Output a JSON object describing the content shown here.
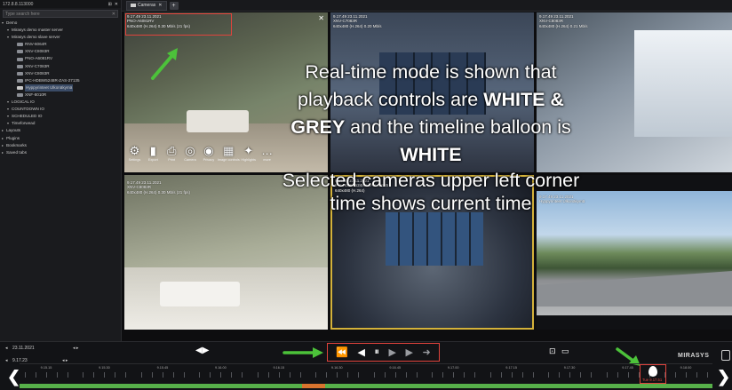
{
  "sidebar": {
    "header": "172.8.8.113000",
    "search_placeholder": "Type search here",
    "tree": [
      {
        "label": "Demo",
        "level": 0,
        "type": "folder"
      },
      {
        "label": "Mirasys demo master server",
        "level": 1,
        "type": "server"
      },
      {
        "label": "Mirasys demo slave server",
        "level": 1,
        "type": "server"
      },
      {
        "label": "RNV-6064R",
        "level": 2,
        "type": "camera"
      },
      {
        "label": "XNV-C8083R",
        "level": 2,
        "type": "camera"
      },
      {
        "label": "PNO-A6081RV",
        "level": 2,
        "type": "camera"
      },
      {
        "label": "XNV-C7083R",
        "level": 2,
        "type": "camera"
      },
      {
        "label": "XNV-C8083R",
        "level": 2,
        "type": "camera"
      },
      {
        "label": "IPC-HDBW5248R-ZAS-27135",
        "level": 2,
        "type": "camera"
      },
      {
        "label": "Hyppyrinteet Ulkonäkymä",
        "level": 2,
        "type": "camera",
        "selected": true
      },
      {
        "label": "XNF-8010R",
        "level": 2,
        "type": "camera"
      },
      {
        "label": "LOGICAL IO",
        "level": 1,
        "type": "folder"
      },
      {
        "label": "COUNTDOWN IO",
        "level": 1,
        "type": "folder"
      },
      {
        "label": "SCHEDULED IO",
        "level": 1,
        "type": "folder"
      },
      {
        "label": "Timeforwead",
        "level": 1,
        "type": "folder"
      },
      {
        "label": "Layouts",
        "level": 0,
        "type": "folder"
      },
      {
        "label": "Plugins",
        "level": 0,
        "type": "folder"
      },
      {
        "label": "Bookmarks",
        "level": 0,
        "type": "folder"
      },
      {
        "label": "Saved tabs",
        "level": 0,
        "type": "folder"
      }
    ]
  },
  "tabs": [
    {
      "label": "Cameras"
    }
  ],
  "cameras": [
    {
      "time": "9.17.49 23.11.2021",
      "name": "PNO-A6081RV",
      "res": "640x480 (H.264) 0.30 Mb/s (21 fps)"
    },
    {
      "time": "9.17.49 23.11.2021",
      "name": "XNV-C7083R",
      "res": "640x480 (H.264) 0.20 Mb/s"
    },
    {
      "time": "9.17.49 23.11.2021",
      "name": "XNV-C8083R",
      "res": "640x480 (H.264) 0.21 Mb/s"
    },
    {
      "time": "9.17.49 23.11.2021",
      "name": "XNV-C8083R",
      "res": "640x480 (H.264) 0.30 Mb/s (21 fps)"
    },
    {
      "time": "9.17.49 23.11.2021",
      "name": "IPC-HDBW5248R-ZAS-27135",
      "res": "640x480 (H.264)"
    },
    {
      "time": "9.17.49 23.11.2021",
      "name": "Hyppyrinteet Ulkonäkymä",
      "res": ""
    }
  ],
  "camera_toolbar": [
    {
      "icon": "gear-icon",
      "glyph": "⚙",
      "label": "Settings"
    },
    {
      "icon": "export-icon",
      "glyph": "▮",
      "label": "Export"
    },
    {
      "icon": "print-icon",
      "glyph": "⎙",
      "label": "Print"
    },
    {
      "icon": "camera-icon",
      "glyph": "◎",
      "label": "Camera"
    },
    {
      "icon": "privacy-icon",
      "glyph": "◉",
      "label": "Privacy"
    },
    {
      "icon": "image-controls-icon",
      "glyph": "▦",
      "label": "Image controls"
    },
    {
      "icon": "highlight-icon",
      "glyph": "✦",
      "label": "Highlights"
    },
    {
      "icon": "more-icon",
      "glyph": "…",
      "label": "more"
    }
  ],
  "overlay": {
    "line1": "Real-time mode is shown that",
    "line2a": "playback controls are ",
    "line2b": "WHITE &",
    "line3a": "GREY",
    "line3b": " and the timeline balloon is",
    "line4": "WHITE",
    "line5": "Selected cameras upper left corner",
    "line6": "time shows current time"
  },
  "bottom": {
    "date": "23.11.2021",
    "time": "9.17.23",
    "brand": "MIRASYS",
    "balloon_time": "Tue 9.17.51",
    "ticks": [
      "9.15.15",
      "9.15.30",
      "9.15.45",
      "9.16.00",
      "9.16.15",
      "9.16.30",
      "9.16.45",
      "9.17.00",
      "9.17.15",
      "9.17.30",
      "9.17.45",
      "9.18.00"
    ]
  },
  "colors": {
    "annotation": "#e0433c",
    "arrow": "#4cc23a",
    "recording": "#57b04a",
    "gap": "#d8742e"
  }
}
